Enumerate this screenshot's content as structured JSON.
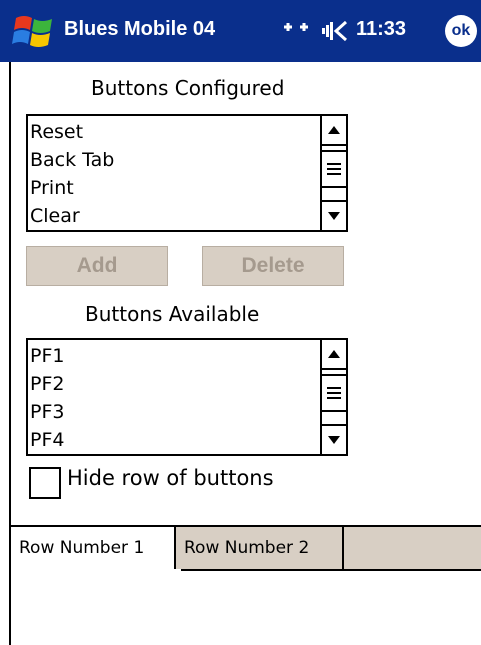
{
  "titlebar": {
    "app_title": "Blues Mobile 04",
    "connectivity": "↔",
    "time": "11:33",
    "ok_label": "ok",
    "bg_color": "#0a2f8c"
  },
  "configured": {
    "label": "Buttons Configured",
    "items": [
      "Reset",
      "Back Tab",
      "Print",
      "Clear"
    ]
  },
  "actions": {
    "add_label": "Add",
    "delete_label": "Delete"
  },
  "available": {
    "label": "Buttons Available",
    "items": [
      "PF1",
      "PF2",
      "PF3",
      "PF4"
    ]
  },
  "hide_row": {
    "label": "Hide row of buttons",
    "checked": false
  },
  "tabs": [
    {
      "label": "Row Number 1",
      "active": true
    },
    {
      "label": "Row Number 2",
      "active": false
    }
  ],
  "colors": {
    "disabled_button_bg": "#d8cfc4",
    "disabled_button_text": "#a59a8e"
  },
  "icons": {
    "start": "windows-flag-icon",
    "connectivity": "connectivity-icon",
    "volume": "speaker-icon"
  }
}
